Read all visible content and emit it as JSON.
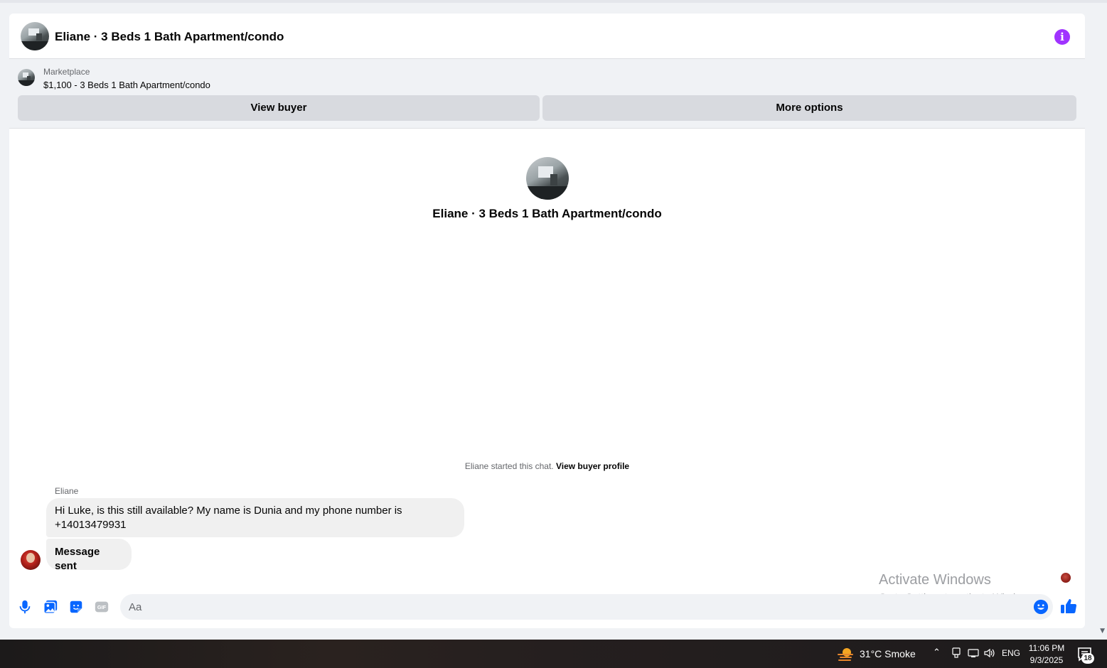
{
  "conversation": {
    "title": "Eliane · 3 Beds 1 Bath Apartment/condo"
  },
  "listing": {
    "source": "Marketplace",
    "title": "$1,100 - 3 Beds 1 Bath Apartment/condo",
    "view_buyer_label": "View buyer",
    "more_options_label": "More options"
  },
  "intro": {
    "title": "Eliane · 3 Beds 1 Bath Apartment/condo"
  },
  "chat_start": {
    "text": "Eliane started this chat.",
    "link": "View buyer profile"
  },
  "messages": [
    {
      "sender": "Eliane",
      "text": "Hi Luke, is this still available? My name is Dunia and my phone number is +14013479931"
    },
    {
      "text": "Message sent"
    }
  ],
  "composer": {
    "placeholder": "Aa"
  },
  "watermark": {
    "title": "Activate Windows",
    "subtitle": "Go to Settings to activate Windows."
  },
  "taskbar": {
    "weather": "31°C  Smoke",
    "language": "ENG",
    "time": "11:06 PM",
    "date": "9/3/2025",
    "notification_count": "18"
  },
  "colors": {
    "accent": "#0866ff",
    "info_purple": "#a033ff",
    "button_bg": "#d8dadf",
    "bubble_bg": "#f0f0f0"
  },
  "icons": [
    "info-icon",
    "microphone-icon",
    "photo-icon",
    "sticker-icon",
    "gif-icon",
    "emoji-icon",
    "thumbs-up-icon",
    "weather-icon",
    "chevron-up-icon",
    "network-icon",
    "wifi-icon",
    "volume-icon",
    "notification-icon"
  ]
}
